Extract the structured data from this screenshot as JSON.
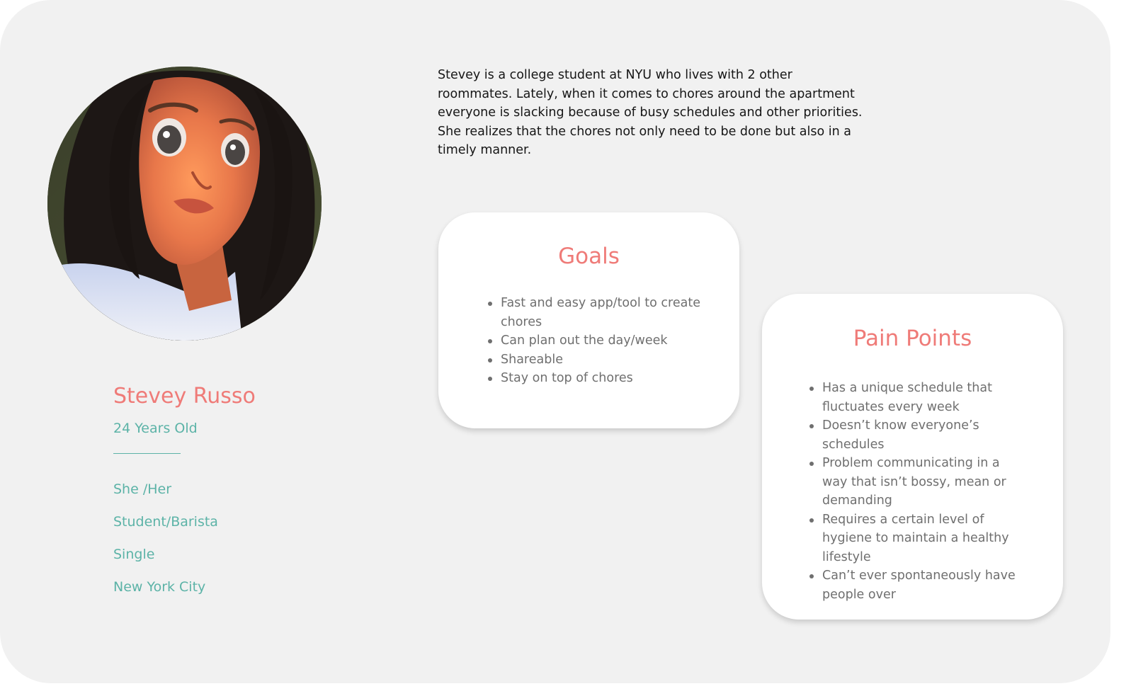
{
  "persona": {
    "name": "Stevey Russo",
    "age": "24 Years Old",
    "details": [
      "She /Her",
      "Student/Barista",
      "Single",
      "New York City"
    ]
  },
  "bio": "Stevey is a college student at NYU who lives with 2 other roommates. Lately, when it comes to chores around the apartment everyone is slacking because of busy schedules and other priorities. She realizes that the chores not only need to be done but also in a timely manner.",
  "goals": {
    "title": "Goals",
    "items": [
      "Fast and easy app/tool to create chores",
      "Can plan out the day/week",
      "Shareable",
      "Stay on top of chores"
    ]
  },
  "pain_points": {
    "title": "Pain Points",
    "items": [
      "Has a unique schedule that fluctuates every week",
      "Doesn’t know everyone’s schedules",
      "Problem communicating in a way that isn’t bossy, mean or demanding",
      "Requires a certain level of hygiene to maintain a healthy lifestyle",
      "Can’t ever spontaneously have people over"
    ]
  },
  "colors": {
    "accent_coral": "#ef7b78",
    "accent_teal": "#5cb3a7",
    "background": "#f1f1f1",
    "card": "#ffffff"
  },
  "avatar": {
    "icon": "persona-portrait-illustration"
  }
}
